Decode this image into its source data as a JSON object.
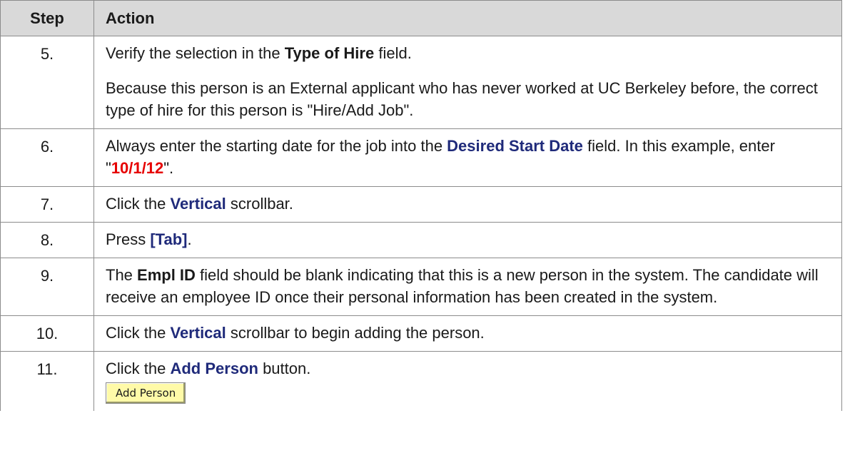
{
  "header": {
    "step": "Step",
    "action": "Action"
  },
  "rows": [
    {
      "step": "5.",
      "line1_pre": "Verify the selection in the ",
      "line1_kw": "Type of Hire",
      "line1_post": " field.",
      "line2": "Because this person is an External applicant who has never worked at UC Berkeley before, the correct type of hire for this person is \"Hire/Add Job\"."
    },
    {
      "step": "6.",
      "pre": "Always enter the starting date for the job into the ",
      "kw": "Desired Start Date",
      "mid": " field. In this example, enter \"",
      "value": "10/1/12",
      "post": "\"."
    },
    {
      "step": "7.",
      "pre": "Click the ",
      "kw": "Vertical",
      "post": " scrollbar."
    },
    {
      "step": "8.",
      "pre": "Press ",
      "kw": "[Tab]",
      "post": "."
    },
    {
      "step": "9.",
      "pre": "The ",
      "kw": "Empl ID",
      "post": " field should be blank indicating that this is a new person in the system. The candidate will receive an employee ID once their personal information has been created in the system."
    },
    {
      "step": "10.",
      "pre": "Click the ",
      "kw": "Vertical",
      "post": " scrollbar to begin adding the person."
    },
    {
      "step": "11.",
      "pre": "Click the ",
      "kw": "Add Person",
      "post": " button.",
      "button_label": "Add Person"
    }
  ],
  "colors": {
    "header_bg": "#d9d9d9",
    "keyword_blue": "#1f2a7a",
    "value_red": "#e60000",
    "button_bg": "#fffaa8"
  }
}
